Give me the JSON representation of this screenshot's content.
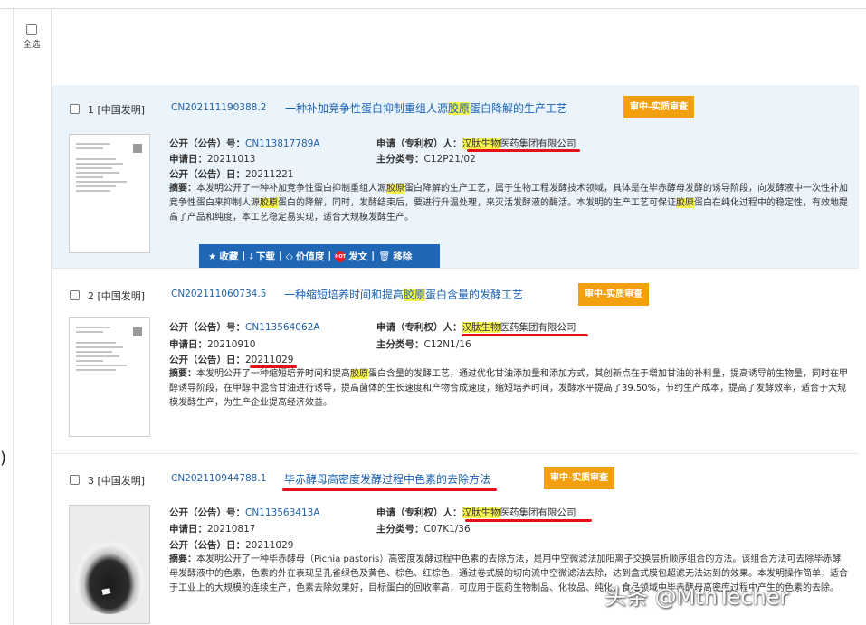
{
  "select_all": {
    "label": "全选"
  },
  "edge_mark": ")",
  "labels": {
    "pub_no": "公开（公告）号：",
    "applicant": "申请（专利权）人：",
    "apply_date": "申请日：",
    "ipc": "主分类号：",
    "pub_date": "公开（公告）日：",
    "abstract": "摘要："
  },
  "results": [
    {
      "index": "1 [中国发明]",
      "app_no": "CN202111190388.2",
      "title": [
        "一种补加竞争性蛋白抑制重组人源",
        "胶原",
        "蛋白降解的生产工艺"
      ],
      "status": "审中-实质审查",
      "pub_no": "CN113817789A",
      "applicant": [
        "汉肽生物",
        "医药集团有限公司"
      ],
      "apply_date": "20211013",
      "ipc": "C12P21/02",
      "pub_date": "20211221",
      "abstract": [
        "本发明公开了一种补加竞争性蛋白抑制重组人源",
        "胶原",
        "蛋白降解的生产工艺，属于生物工程发酵技术领域，具体是在毕赤酵母发酵的诱导阶段，向发酵液中一次性补加竞争性蛋白来抑制人源",
        "胶原",
        "蛋白的降解，同时，发酵结束后，要进行升温处理，来灭活发酵液的酶活。本发明的生产工艺可保证",
        "胶原",
        "蛋白在纯化过程中的稳定性，有效地提高了产品和纯度，本工艺稳定易实现，适合大规模发酵生产。"
      ]
    },
    {
      "index": "2 [中国发明]",
      "app_no": "CN202111060734.5",
      "title": [
        "一种缩短培养时间和提高",
        "胶原",
        "蛋白含量的发酵工艺"
      ],
      "status": "审中-实质审查",
      "pub_no": "CN113564062A",
      "applicant": [
        "汉肽生物",
        "医药集团有限公司"
      ],
      "apply_date": "20210910",
      "ipc": "C12N1/16",
      "pub_date": "20211029",
      "abstract": [
        "本发明公开了一种缩短培养时间和提高",
        "胶原",
        "蛋白含量的发酵工艺，通过优化甘油添加量和添加方式，其创新点在于增加甘油的补料量，提高诱导前生物量，同时在甲醇诱导阶段，在甲醇中混合甘油进行诱导，提高菌体的生长速度和产物合成速度，缩短培养时间，发酵水平提高了39.50%，节约生产成本，提高了发酵效率，适合于大规模发酵生产，为生产企业提高经济效益。"
      ]
    },
    {
      "index": "3 [中国发明]",
      "app_no": "CN202110944788.1",
      "title": [
        "毕赤酵母高密度发酵过程中色素的去除方法"
      ],
      "status": "审中-实质审查",
      "pub_no": "CN113563413A",
      "applicant": [
        "汉肽生物",
        "医药集团有限公司"
      ],
      "apply_date": "20210817",
      "ipc": "C07K1/36",
      "pub_date": "20211029",
      "abstract": [
        "本发明公开了一种毕赤酵母（Pichia pastoris）高密度发酵过程中色素的去除方法，是用中空微滤法加阳离子交换层析顺序组合的方法。该组合方法可去除毕赤酵母发酵液中的色素，色素的外在表现呈孔雀绿色及黄色、棕色、红棕色，通过卷式膜的切向流中空微滤法去除，达到盒式膜包超滤无法达到的效果。本发明操作简单，适合于工业上的大规模的连续生产，色素去除效果好，目标蛋白的回收率高，可应用于医药生物制品、化妆品、纯化、食品领域中毕赤酵母高密度过程中产生的色素的去除。"
      ]
    }
  ],
  "toolbar": {
    "collect": "收藏",
    "download": "下载",
    "value": "价值度",
    "hot_badge": "HOT",
    "publish": "发文",
    "remove": "移除",
    "sep": "|"
  },
  "watermark": "头条 @MtnTecher"
}
